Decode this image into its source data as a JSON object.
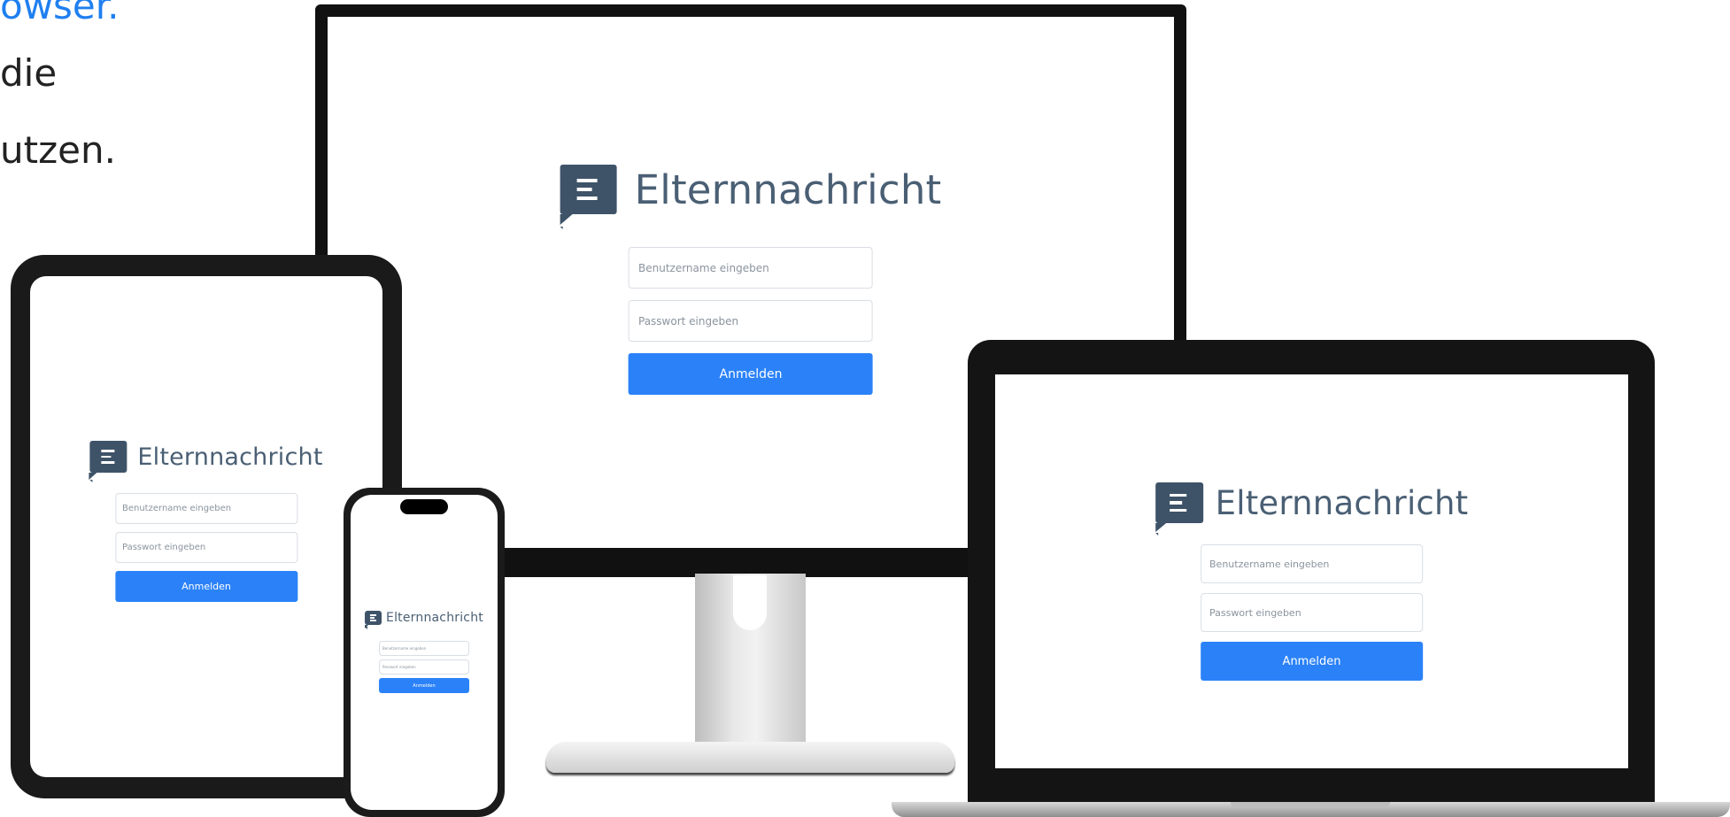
{
  "headline": {
    "line1": "owser.",
    "line2": "die",
    "line3": "utzen."
  },
  "login": {
    "brand": "Elternnachricht",
    "username_placeholder": "Benutzername eingeben",
    "password_placeholder": "Passwort eingeben",
    "submit_label": "Anmelden"
  },
  "colors": {
    "accent": "#2b82f8",
    "brand_text": "#4a5f74",
    "logo": "#3e5368",
    "headline_link": "#1f7ff0"
  },
  "icons": {
    "logo": "message-bubble-icon"
  }
}
